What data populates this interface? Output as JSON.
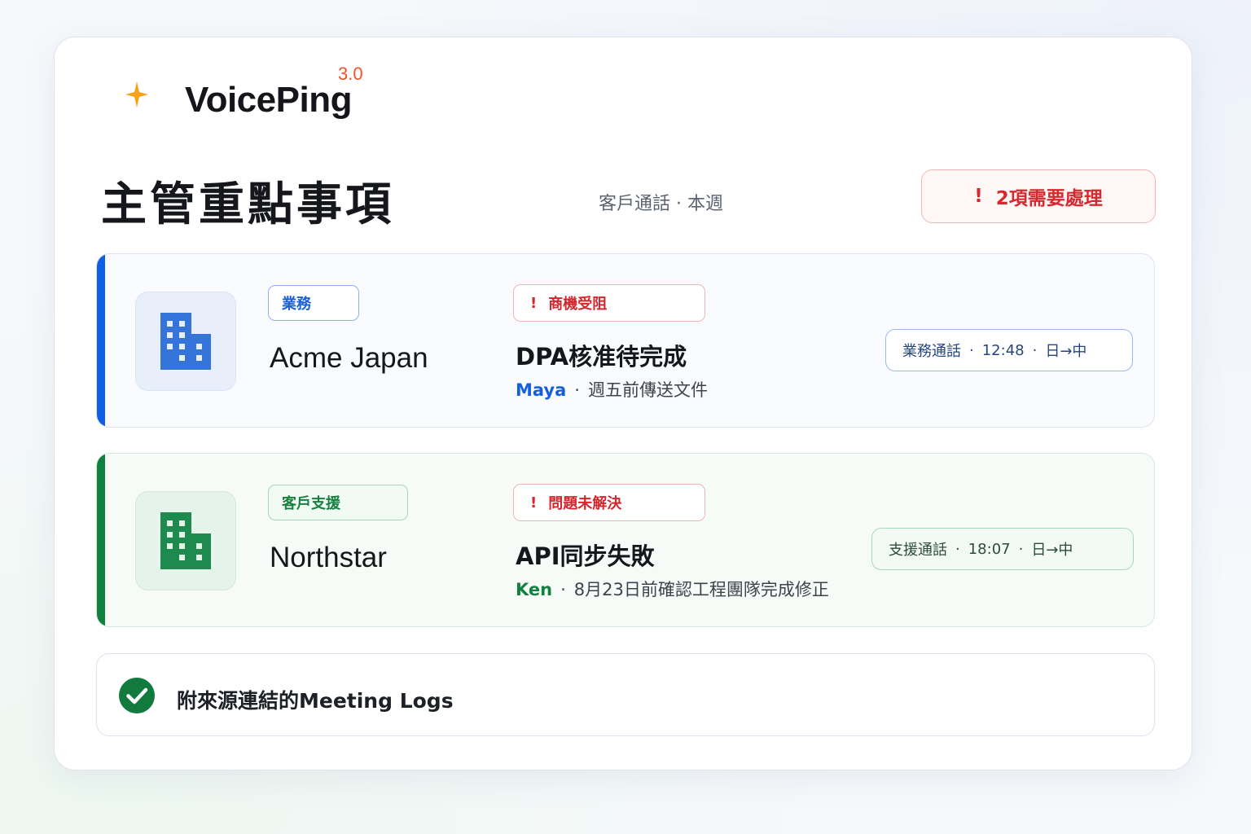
{
  "brand": {
    "name": "VoicePing",
    "version": "3.0",
    "colors": {
      "wordmark": "#14161b",
      "version": "#f0522d"
    }
  },
  "header": {
    "title": "主管重點事項",
    "subtitle": "客戶通話 · 本週",
    "alert": {
      "icon": "!",
      "label": "2項需要處理",
      "color": "#d42a2f"
    }
  },
  "items": [
    {
      "accent": "#0f5fe6",
      "icon": "building-icon",
      "tag": "業務",
      "company": "Acme Japan",
      "status": {
        "icon": "!",
        "label": "商機受阻"
      },
      "title": "DPA核准待完成",
      "owner": "Maya",
      "meta_sep": "·",
      "action": "週五前傳送文件",
      "call": {
        "type": "業務通話",
        "sep": "·",
        "time": "12:48",
        "lang": "日→中"
      }
    },
    {
      "accent": "#10803f",
      "icon": "building-icon",
      "tag": "客戶支援",
      "company": "Northstar",
      "status": {
        "icon": "!",
        "label": "問題未解決"
      },
      "title": "API同步失敗",
      "owner": "Ken",
      "meta_sep": "·",
      "action": "8月23日前確認工程團隊完成修正",
      "call": {
        "type": "支援通話",
        "sep": "·",
        "time": "18:07",
        "lang": "日→中"
      }
    }
  ],
  "footer": {
    "icon": "check-circle-icon",
    "label": "附來源連結的Meeting Logs"
  }
}
